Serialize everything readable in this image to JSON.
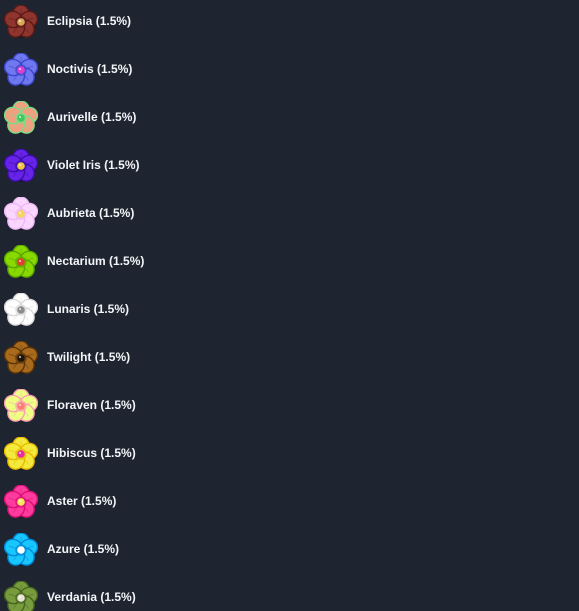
{
  "flowers": [
    {
      "label": "Eclipsia (1.5%)",
      "icon": "eclipsia-flower-icon",
      "colors": {
        "petal": "#8f3530",
        "edge": "#5a1915",
        "center": "#d8a85a"
      }
    },
    {
      "label": "Noctivis (1.5%)",
      "icon": "noctivis-flower-icon",
      "colors": {
        "petal": "#6f78ef",
        "edge": "#3b45c8",
        "center": "#e03dd7"
      }
    },
    {
      "label": "Aurivelle (1.5%)",
      "icon": "aurivelle-flower-icon",
      "colors": {
        "petal": "#f0a07e",
        "edge": "#7bdc86",
        "center": "#3ec85f"
      }
    },
    {
      "label": "Violet Iris (1.5%)",
      "icon": "violet-iris-flower-icon",
      "colors": {
        "petal": "#6724e8",
        "edge": "#3b0ea8",
        "center": "#f1c640"
      }
    },
    {
      "label": "Aubrieta (1.5%)",
      "icon": "aubrieta-flower-icon",
      "colors": {
        "petal": "#fbd7ff",
        "edge": "#efb6f5",
        "center": "#f5d65b"
      }
    },
    {
      "label": "Nectarium (1.5%)",
      "icon": "nectarium-flower-icon",
      "colors": {
        "petal": "#89d800",
        "edge": "#57a600",
        "center": "#e83d2d"
      }
    },
    {
      "label": "Lunaris (1.5%)",
      "icon": "lunaris-flower-icon",
      "colors": {
        "petal": "#ffffff",
        "edge": "#d8d8d8",
        "center": "#8d8d8d"
      }
    },
    {
      "label": "Twilight (1.5%)",
      "icon": "twilight-flower-icon",
      "colors": {
        "petal": "#a86b1d",
        "edge": "#5d3305",
        "center": "#1f140d"
      }
    },
    {
      "label": "Floraven (1.5%)",
      "icon": "floraven-flower-icon",
      "colors": {
        "petal": "#efff84",
        "edge": "#fb9db5",
        "center": "#ff7d71"
      }
    },
    {
      "label": "Hibiscus (1.5%)",
      "icon": "hibiscus-flower-icon",
      "colors": {
        "petal": "#f4e93d",
        "edge": "#e7b800",
        "center": "#e62ca6"
      }
    },
    {
      "label": "Aster (1.5%)",
      "icon": "aster-flower-icon",
      "colors": {
        "petal": "#ff3b9d",
        "edge": "#d80f77",
        "center": "#f4e75a"
      }
    },
    {
      "label": "Azure (1.5%)",
      "icon": "azure-flower-icon",
      "colors": {
        "petal": "#18c7ff",
        "edge": "#0087d5",
        "center": "#ffffff"
      }
    },
    {
      "label": "Verdania (1.5%)",
      "icon": "verdania-flower-icon",
      "colors": {
        "petal": "#789c3d",
        "edge": "#45641f",
        "center": "#e8e4d7"
      }
    }
  ]
}
